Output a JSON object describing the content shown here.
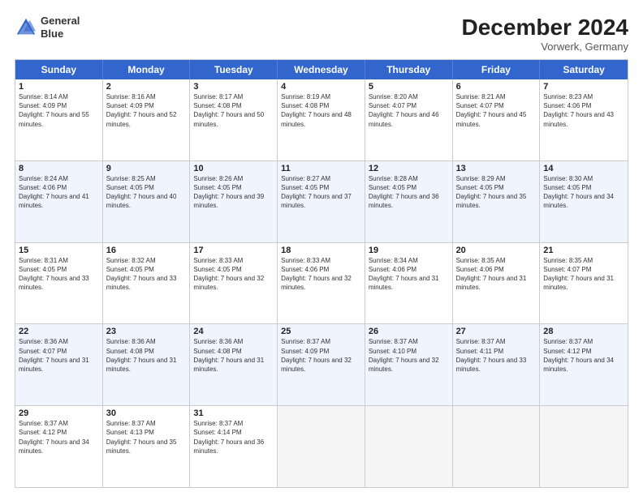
{
  "logo": {
    "line1": "General",
    "line2": "Blue"
  },
  "title": "December 2024",
  "subtitle": "Vorwerk, Germany",
  "days": [
    "Sunday",
    "Monday",
    "Tuesday",
    "Wednesday",
    "Thursday",
    "Friday",
    "Saturday"
  ],
  "rows": [
    [
      {
        "day": "1",
        "sunrise": "Sunrise: 8:14 AM",
        "sunset": "Sunset: 4:09 PM",
        "daylight": "Daylight: 7 hours and 55 minutes."
      },
      {
        "day": "2",
        "sunrise": "Sunrise: 8:16 AM",
        "sunset": "Sunset: 4:09 PM",
        "daylight": "Daylight: 7 hours and 52 minutes."
      },
      {
        "day": "3",
        "sunrise": "Sunrise: 8:17 AM",
        "sunset": "Sunset: 4:08 PM",
        "daylight": "Daylight: 7 hours and 50 minutes."
      },
      {
        "day": "4",
        "sunrise": "Sunrise: 8:19 AM",
        "sunset": "Sunset: 4:08 PM",
        "daylight": "Daylight: 7 hours and 48 minutes."
      },
      {
        "day": "5",
        "sunrise": "Sunrise: 8:20 AM",
        "sunset": "Sunset: 4:07 PM",
        "daylight": "Daylight: 7 hours and 46 minutes."
      },
      {
        "day": "6",
        "sunrise": "Sunrise: 8:21 AM",
        "sunset": "Sunset: 4:07 PM",
        "daylight": "Daylight: 7 hours and 45 minutes."
      },
      {
        "day": "7",
        "sunrise": "Sunrise: 8:23 AM",
        "sunset": "Sunset: 4:06 PM",
        "daylight": "Daylight: 7 hours and 43 minutes."
      }
    ],
    [
      {
        "day": "8",
        "sunrise": "Sunrise: 8:24 AM",
        "sunset": "Sunset: 4:06 PM",
        "daylight": "Daylight: 7 hours and 41 minutes."
      },
      {
        "day": "9",
        "sunrise": "Sunrise: 8:25 AM",
        "sunset": "Sunset: 4:05 PM",
        "daylight": "Daylight: 7 hours and 40 minutes."
      },
      {
        "day": "10",
        "sunrise": "Sunrise: 8:26 AM",
        "sunset": "Sunset: 4:05 PM",
        "daylight": "Daylight: 7 hours and 39 minutes."
      },
      {
        "day": "11",
        "sunrise": "Sunrise: 8:27 AM",
        "sunset": "Sunset: 4:05 PM",
        "daylight": "Daylight: 7 hours and 37 minutes."
      },
      {
        "day": "12",
        "sunrise": "Sunrise: 8:28 AM",
        "sunset": "Sunset: 4:05 PM",
        "daylight": "Daylight: 7 hours and 36 minutes."
      },
      {
        "day": "13",
        "sunrise": "Sunrise: 8:29 AM",
        "sunset": "Sunset: 4:05 PM",
        "daylight": "Daylight: 7 hours and 35 minutes."
      },
      {
        "day": "14",
        "sunrise": "Sunrise: 8:30 AM",
        "sunset": "Sunset: 4:05 PM",
        "daylight": "Daylight: 7 hours and 34 minutes."
      }
    ],
    [
      {
        "day": "15",
        "sunrise": "Sunrise: 8:31 AM",
        "sunset": "Sunset: 4:05 PM",
        "daylight": "Daylight: 7 hours and 33 minutes."
      },
      {
        "day": "16",
        "sunrise": "Sunrise: 8:32 AM",
        "sunset": "Sunset: 4:05 PM",
        "daylight": "Daylight: 7 hours and 33 minutes."
      },
      {
        "day": "17",
        "sunrise": "Sunrise: 8:33 AM",
        "sunset": "Sunset: 4:05 PM",
        "daylight": "Daylight: 7 hours and 32 minutes."
      },
      {
        "day": "18",
        "sunrise": "Sunrise: 8:33 AM",
        "sunset": "Sunset: 4:06 PM",
        "daylight": "Daylight: 7 hours and 32 minutes."
      },
      {
        "day": "19",
        "sunrise": "Sunrise: 8:34 AM",
        "sunset": "Sunset: 4:06 PM",
        "daylight": "Daylight: 7 hours and 31 minutes."
      },
      {
        "day": "20",
        "sunrise": "Sunrise: 8:35 AM",
        "sunset": "Sunset: 4:06 PM",
        "daylight": "Daylight: 7 hours and 31 minutes."
      },
      {
        "day": "21",
        "sunrise": "Sunrise: 8:35 AM",
        "sunset": "Sunset: 4:07 PM",
        "daylight": "Daylight: 7 hours and 31 minutes."
      }
    ],
    [
      {
        "day": "22",
        "sunrise": "Sunrise: 8:36 AM",
        "sunset": "Sunset: 4:07 PM",
        "daylight": "Daylight: 7 hours and 31 minutes."
      },
      {
        "day": "23",
        "sunrise": "Sunrise: 8:36 AM",
        "sunset": "Sunset: 4:08 PM",
        "daylight": "Daylight: 7 hours and 31 minutes."
      },
      {
        "day": "24",
        "sunrise": "Sunrise: 8:36 AM",
        "sunset": "Sunset: 4:08 PM",
        "daylight": "Daylight: 7 hours and 31 minutes."
      },
      {
        "day": "25",
        "sunrise": "Sunrise: 8:37 AM",
        "sunset": "Sunset: 4:09 PM",
        "daylight": "Daylight: 7 hours and 32 minutes."
      },
      {
        "day": "26",
        "sunrise": "Sunrise: 8:37 AM",
        "sunset": "Sunset: 4:10 PM",
        "daylight": "Daylight: 7 hours and 32 minutes."
      },
      {
        "day": "27",
        "sunrise": "Sunrise: 8:37 AM",
        "sunset": "Sunset: 4:11 PM",
        "daylight": "Daylight: 7 hours and 33 minutes."
      },
      {
        "day": "28",
        "sunrise": "Sunrise: 8:37 AM",
        "sunset": "Sunset: 4:12 PM",
        "daylight": "Daylight: 7 hours and 34 minutes."
      }
    ],
    [
      {
        "day": "29",
        "sunrise": "Sunrise: 8:37 AM",
        "sunset": "Sunset: 4:12 PM",
        "daylight": "Daylight: 7 hours and 34 minutes."
      },
      {
        "day": "30",
        "sunrise": "Sunrise: 8:37 AM",
        "sunset": "Sunset: 4:13 PM",
        "daylight": "Daylight: 7 hours and 35 minutes."
      },
      {
        "day": "31",
        "sunrise": "Sunrise: 8:37 AM",
        "sunset": "Sunset: 4:14 PM",
        "daylight": "Daylight: 7 hours and 36 minutes."
      },
      null,
      null,
      null,
      null
    ]
  ]
}
